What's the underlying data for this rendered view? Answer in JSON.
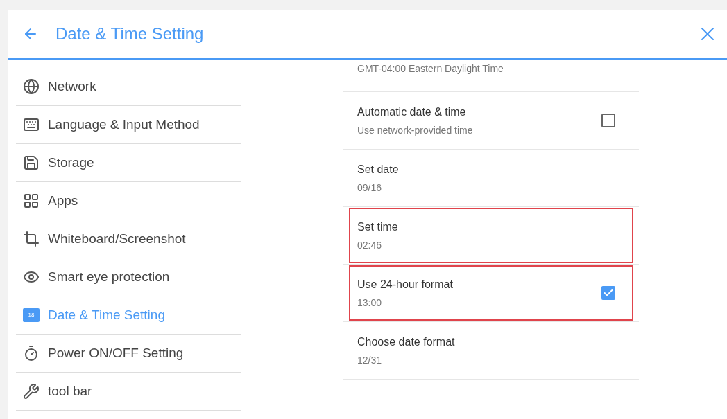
{
  "header": {
    "title": "Date & Time Setting"
  },
  "sidebar": {
    "items": [
      {
        "label": "Network",
        "selected": false
      },
      {
        "label": "Language & Input Method",
        "selected": false
      },
      {
        "label": "Storage",
        "selected": false
      },
      {
        "label": "Apps",
        "selected": false
      },
      {
        "label": "Whiteboard/Screenshot",
        "selected": false
      },
      {
        "label": "Smart eye protection",
        "selected": false
      },
      {
        "label": "Date & Time Setting",
        "icon_text": "18",
        "selected": true
      },
      {
        "label": "Power ON/OFF Setting",
        "selected": false
      },
      {
        "label": "tool bar",
        "selected": false
      }
    ]
  },
  "settings": [
    {
      "kind": "value",
      "subtitle": "GMT-04:00 Eastern Daylight Time",
      "highlighted": false
    },
    {
      "kind": "checkbox",
      "title": "Automatic date & time",
      "subtitle": "Use network-provided time",
      "checked": false,
      "highlighted": false
    },
    {
      "kind": "value",
      "title": "Set date",
      "subtitle": "09/16",
      "highlighted": false
    },
    {
      "kind": "value",
      "title": "Set time",
      "subtitle": "02:46",
      "highlighted": true
    },
    {
      "kind": "checkbox",
      "title": "Use 24-hour format",
      "subtitle": "13:00",
      "checked": true,
      "highlighted": true
    },
    {
      "kind": "value",
      "title": "Choose date format",
      "subtitle": "12/31",
      "highlighted": false
    }
  ]
}
